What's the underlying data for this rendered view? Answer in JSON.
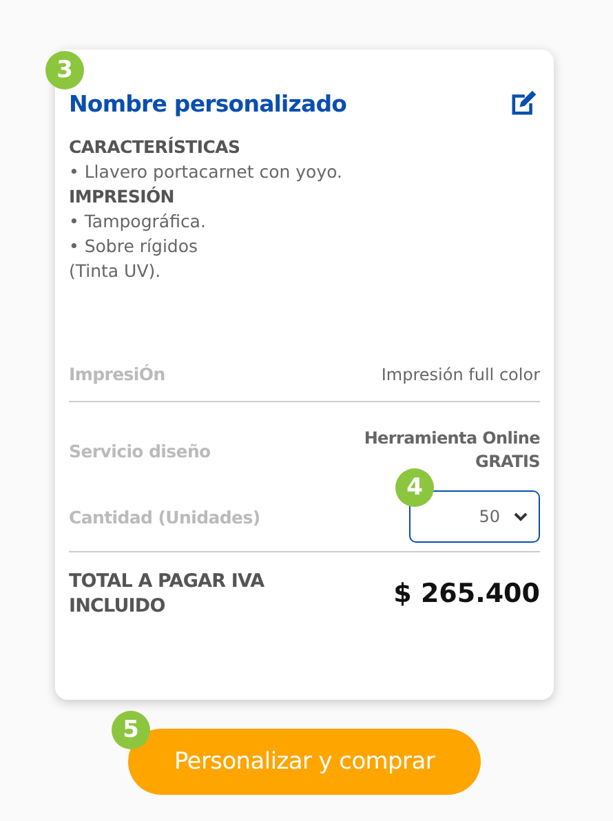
{
  "card": {
    "step": "3",
    "title": "Nombre personalizado",
    "description": [
      {
        "kind": "heading",
        "text": "CARACTERÍSTICAS"
      },
      {
        "kind": "text",
        "text": "• Llavero portacarnet con yoyo."
      },
      {
        "kind": "heading",
        "text": "IMPRESIÓN"
      },
      {
        "kind": "text",
        "text": "• Tampográfica."
      },
      {
        "kind": "text",
        "text": "• Sobre rígidos"
      },
      {
        "kind": "text",
        "text": "(Tinta UV)."
      }
    ],
    "rows": [
      {
        "kind": "text",
        "label": "ImpresiÓn",
        "value": "Impresión full color"
      },
      {
        "kind": "bold",
        "label": "Servicio diseño",
        "value": "Herramienta Online GRATIS"
      },
      {
        "kind": "select",
        "label": "Cantidad (Unidades)",
        "value": "50",
        "step": "4"
      }
    ],
    "total": {
      "label": "TOTAL A PAGAR IVA INCLUIDO",
      "value": "$ 265.400"
    }
  },
  "button": {
    "step": "5",
    "label": "Personalizar y comprar"
  }
}
